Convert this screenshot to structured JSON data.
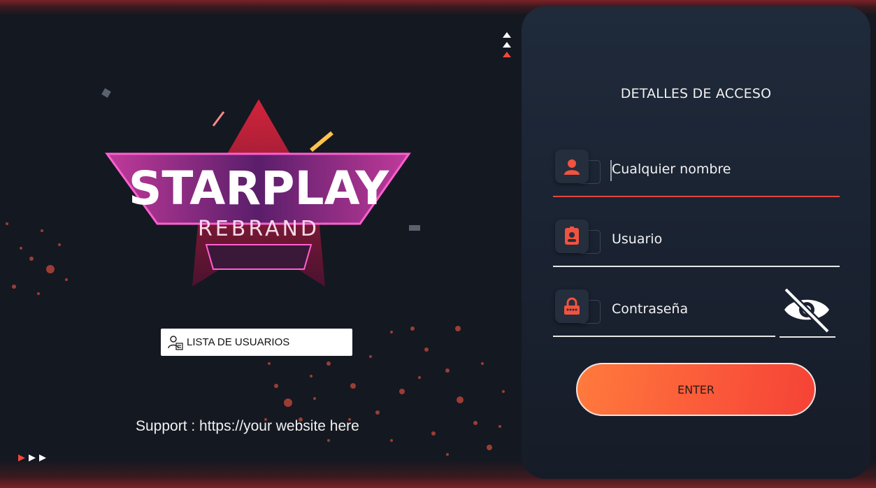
{
  "brand": {
    "title": "STARPLAY",
    "subtitle": "REBRAND"
  },
  "users_button": {
    "label": "LISTA DE USUARIOS",
    "icon": "users-list-icon"
  },
  "support": {
    "text": "Support : https://your website here"
  },
  "login": {
    "title": "DETALLES DE ACCESO",
    "fields": [
      {
        "icon": "person-icon",
        "value": "Cualquier nombre"
      },
      {
        "icon": "id-card-icon",
        "value": "Usuario"
      },
      {
        "icon": "lock-icon",
        "value": "Contraseña"
      }
    ],
    "toggle_icon": "eye-slash-icon",
    "enter_label": "ENTER"
  },
  "colors": {
    "accent": "#f0473b",
    "panel": "#1f2a3a",
    "background": "#141821",
    "button": "#fb5a3a"
  }
}
